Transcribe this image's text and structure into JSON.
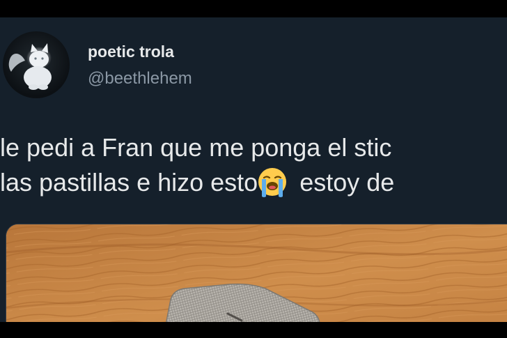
{
  "user": {
    "display_name": "poetic trola",
    "handle": "@beethlehem"
  },
  "tweet": {
    "line1": "le pedi a Fran que me ponga el stic",
    "line2_before_emoji": "las pastillas e hizo esto",
    "line2_after_emoji": " estoy de",
    "emoji": "loudly-crying-face-emoji"
  },
  "media": {
    "description_icon": "wooden-table-with-pill-strip-image"
  },
  "colors": {
    "background": "#15202b",
    "text": "#e7e9ea",
    "secondary_text": "#8b98a5",
    "letterbox": "#000000"
  }
}
